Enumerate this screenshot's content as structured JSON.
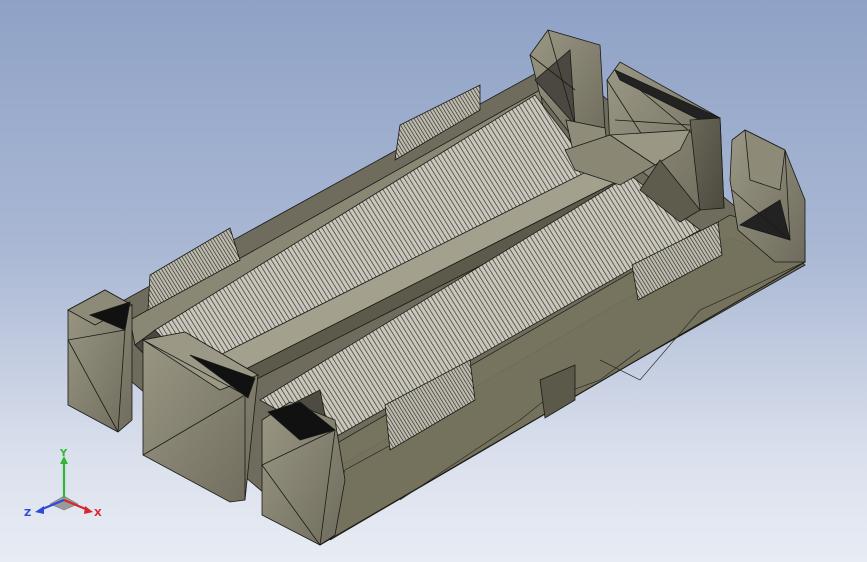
{
  "viewport": {
    "background_top": "#8fa2c6",
    "background_bottom": "#e8ecf4",
    "model": {
      "part_color": "#7d7a6a",
      "part_dark": "#3a382f",
      "part_light": "#a6a391",
      "edge_color": "#1a1a16"
    }
  },
  "triad": {
    "y_label": "Y",
    "z_label": "Z",
    "x_label": "X",
    "y_color": "#2fb82f",
    "z_color": "#2d4bd8",
    "x_color": "#d8262d"
  }
}
